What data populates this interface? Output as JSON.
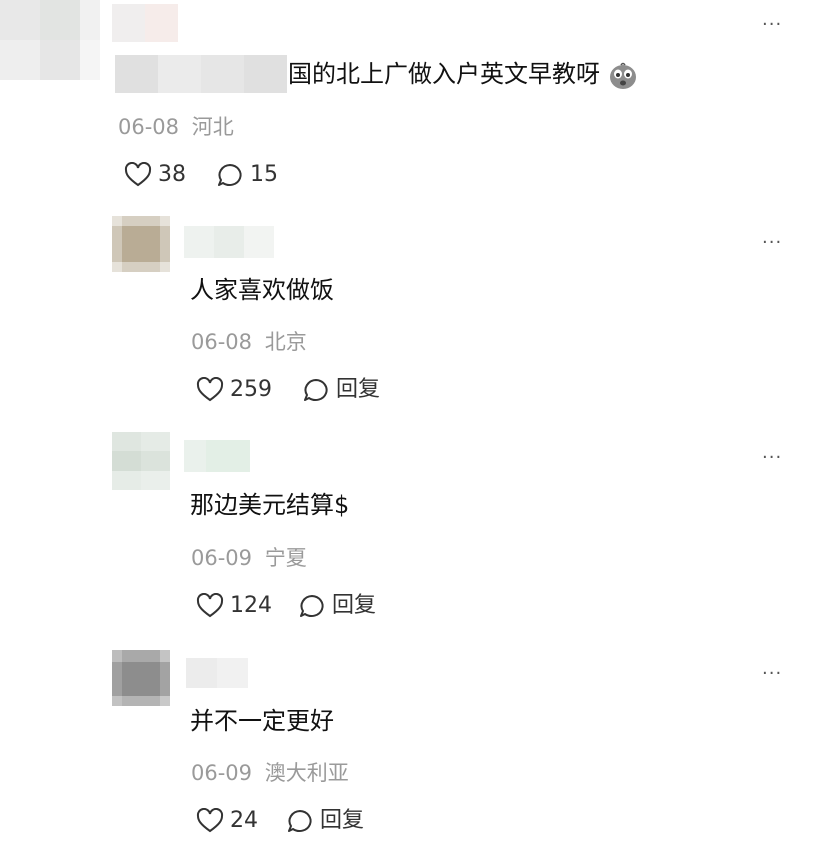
{
  "comments": [
    {
      "text": "国的北上广做入户英文早教呀",
      "date": "06-08",
      "location": "河北",
      "likes": "38",
      "replies": "15",
      "icon": "comment-bubble-icon"
    },
    {
      "text": "人家喜欢做饭",
      "date": "06-08",
      "location": "北京",
      "likes": "259",
      "reply_label": "回复"
    },
    {
      "text": "那边美元结算$",
      "date": "06-09",
      "location": "宁夏",
      "likes": "124",
      "reply_label": "回复"
    },
    {
      "text": "并不一定更好",
      "date": "06-09",
      "location": "澳大利亚",
      "likes": "24",
      "reply_label": "回复"
    }
  ],
  "more_label": "···",
  "colors": {
    "text": "#111111",
    "meta": "#9a9a9a",
    "icon": "#333333"
  },
  "icons": [
    "heart-icon",
    "comment-bubble-icon",
    "more-options-icon",
    "grimace-emoji-icon"
  ]
}
